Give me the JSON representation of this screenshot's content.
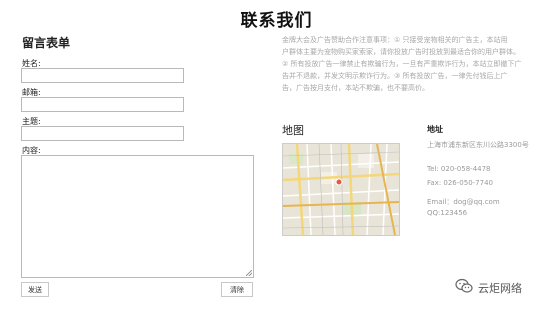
{
  "page": {
    "title": "联系我们"
  },
  "form": {
    "title": "留言表单",
    "name_label": "姓名:",
    "email_label": "邮箱:",
    "subject_label": "主题:",
    "content_label": "内容:",
    "send_label": "发送",
    "clear_label": "清除"
  },
  "notice": {
    "lines": [
      "金牌大会及广告赞助合作注意事项：① 只接受宠物相关的广告主，本站用",
      "户群体主要为宠物购买家索家，请你投放广告时投放到最适合你的用户群体。",
      "② 所有投放广告一律禁止有欺骗行为，一旦有严重欺诈行为，本站立即撤下广",
      "告并不退款，并发文明示欺诈行为。③ 所有投放广告，一律先付钱后上广",
      "告，广告按月支付，本站不欺骗，也不要高价。"
    ]
  },
  "map": {
    "title": "地图"
  },
  "address": {
    "title": "地址",
    "street": "上海市浦东新区东川公路3300号",
    "tel": "Tel: 020-058-4478",
    "fax": "Fax: 026-050-7740",
    "email": "Email：dog@qq.com",
    "qq": "QQ:123456"
  },
  "watermark": {
    "text": "云炬网络",
    "icon": "wechat-icon"
  }
}
